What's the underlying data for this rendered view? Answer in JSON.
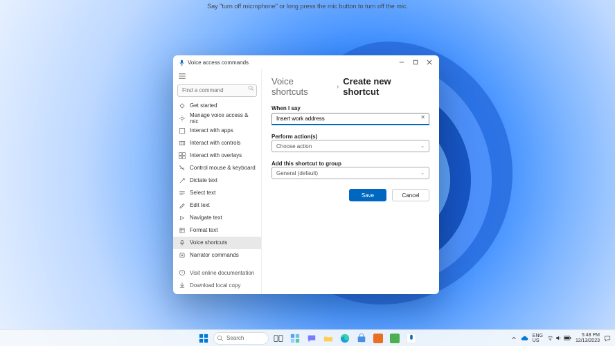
{
  "top_hint": "Say \"turn off microphone\" or long press the mic button to turn off the mic.",
  "window": {
    "title": "Voice access commands",
    "search_placeholder": "Find a command",
    "sidebar": {
      "items": [
        {
          "label": "Get started"
        },
        {
          "label": "Manage voice access & mic"
        },
        {
          "label": "Interact with apps"
        },
        {
          "label": "Interact with controls"
        },
        {
          "label": "Interact with overlays"
        },
        {
          "label": "Control mouse & keyboard"
        },
        {
          "label": "Dictate text"
        },
        {
          "label": "Select text"
        },
        {
          "label": "Edit text"
        },
        {
          "label": "Navigate text"
        },
        {
          "label": "Format text"
        },
        {
          "label": "Voice shortcuts"
        },
        {
          "label": "Narrator commands"
        }
      ],
      "footer": [
        {
          "label": "Visit online documentation"
        },
        {
          "label": "Download local copy"
        }
      ]
    },
    "breadcrumb": {
      "root": "Voice shortcuts",
      "leaf": "Create new shortcut"
    },
    "form": {
      "say_label": "When I say",
      "say_value": "Insert work address",
      "action_label": "Perform action(s)",
      "action_placeholder": "Choose action",
      "group_label": "Add this shortcut to group",
      "group_value": "General (default)",
      "save": "Save",
      "cancel": "Cancel"
    }
  },
  "taskbar": {
    "search_placeholder": "Search",
    "lang": "ENG",
    "region": "US",
    "time": "5:48 PM",
    "date": "12/13/2023"
  }
}
